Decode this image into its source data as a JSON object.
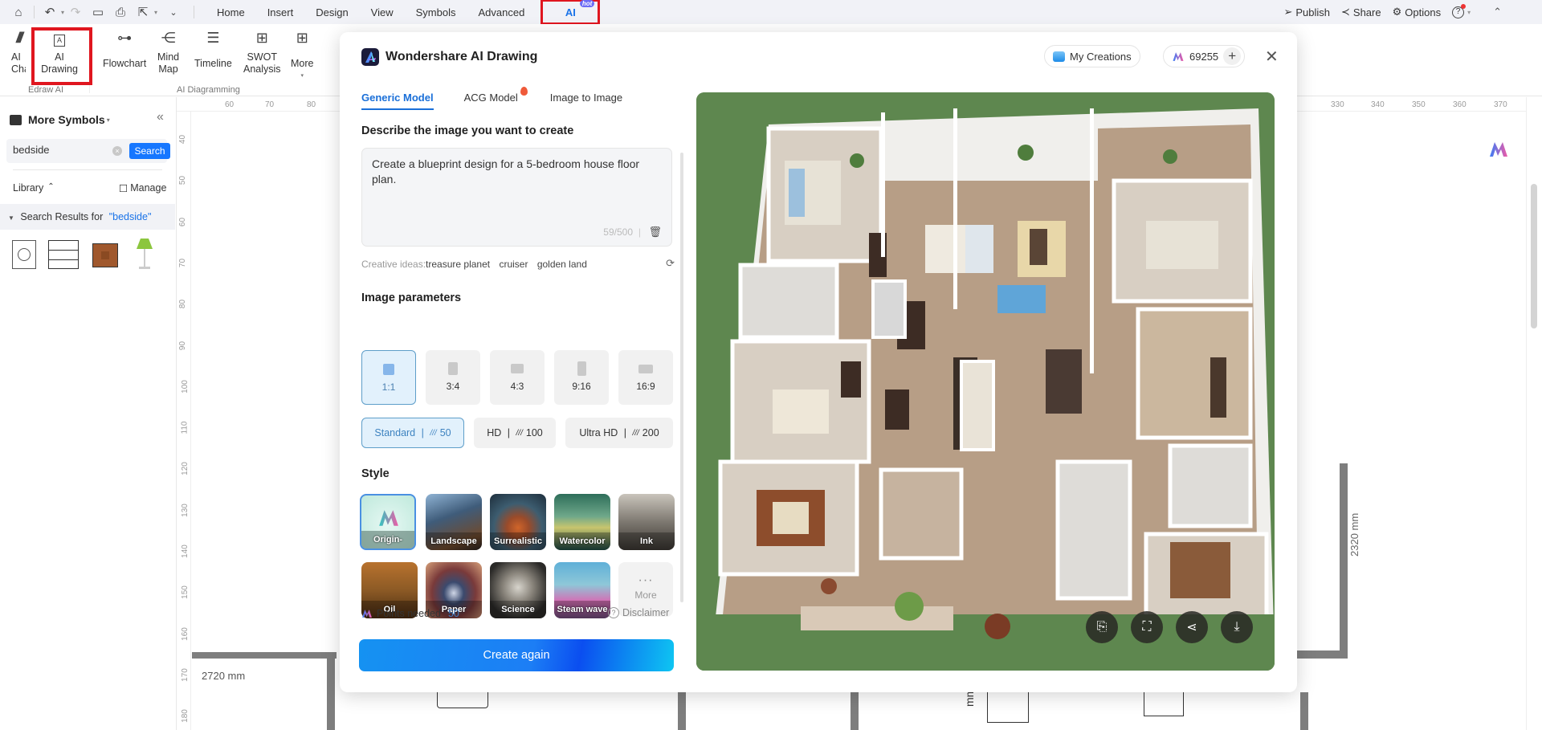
{
  "topbar": {
    "quick_icons": [
      "home-icon",
      "undo-icon",
      "redo-icon",
      "save-icon",
      "print-icon",
      "export-icon",
      "more-dropdown-icon"
    ],
    "menu": [
      "Home",
      "Insert",
      "Design",
      "View",
      "Symbols",
      "Advanced",
      "AI"
    ],
    "hot_badge": "hot",
    "actions": {
      "publish": "Publish",
      "share": "Share",
      "options": "Options"
    }
  },
  "ribbon": {
    "buttons": [
      {
        "label": "AI\nCha",
        "name": "ai-chat"
      },
      {
        "label": "AI\nDrawing",
        "name": "ai-drawing"
      },
      {
        "label": "Flowchart",
        "name": "flowchart"
      },
      {
        "label": "Mind\nMap",
        "name": "mind-map"
      },
      {
        "label": "Timeline",
        "name": "timeline"
      },
      {
        "label": "SWOT\nAnalysis",
        "name": "swot-analysis"
      },
      {
        "label": "More",
        "name": "more"
      }
    ],
    "groups": {
      "edraw_ai": "Edraw AI",
      "ai_diagramming": "AI Diagramming"
    }
  },
  "sidebar": {
    "title": "More Symbols",
    "search_value": "bedside",
    "search_button": "Search",
    "library_label": "Library",
    "manage_label": "Manage",
    "results_prefix": "Search Results for",
    "results_query": "\"bedside\"",
    "symbols": [
      "bedside-lamp-symbol",
      "bedside-drawer-symbol",
      "bedside-table-symbol",
      "table-lamp-symbol"
    ]
  },
  "ruler": {
    "top": [
      "60",
      "70",
      "80",
      "330",
      "340",
      "350",
      "360",
      "370"
    ],
    "left": [
      "40",
      "50",
      "60",
      "70",
      "80",
      "90",
      "100",
      "110",
      "120",
      "130",
      "140",
      "150",
      "160",
      "170",
      "180"
    ]
  },
  "canvas": {
    "dim_bottom_left": "2720 mm",
    "dim_right": "2320 mm",
    "dim_partial": "mm x"
  },
  "dialog": {
    "title": "Wondershare AI Drawing",
    "my_creations": "My Creations",
    "points_balance": "69255",
    "tabs": [
      "Generic Model",
      "ACG Model",
      "Image to Image"
    ],
    "active_tab": "Generic Model",
    "describe_heading": "Describe the image you want to create",
    "prompt": "Create a blueprint design for a 5-bedroom house floor plan.",
    "char_count": "59/500",
    "creative_label": "Creative ideas:",
    "creative_ideas": [
      "treasure planet",
      "cruiser",
      "golden land"
    ],
    "params_heading": "Image parameters",
    "ratios": [
      "1:1",
      "3:4",
      "4:3",
      "9:16",
      "16:9"
    ],
    "selected_ratio": "1:1",
    "qualities": [
      {
        "label": "Standard",
        "cost": "50"
      },
      {
        "label": "HD",
        "cost": "100"
      },
      {
        "label": "Ultra HD",
        "cost": "200"
      }
    ],
    "selected_quality": "Standard",
    "style_heading": "Style",
    "styles": [
      "Origin-com...",
      "Landscape",
      "Surrealistic",
      "Watercolor",
      "Ink",
      "Oil",
      "Paper",
      "Science",
      "Steam wave"
    ],
    "selected_style": "Origin-com...",
    "more_label": "More",
    "points_needed_label": "Points needed",
    "points_needed_value": "50",
    "disclaimer": "Disclaimer",
    "create_button": "Create again",
    "preview_actions": [
      "edit-icon",
      "fullscreen-icon",
      "share-icon",
      "download-icon"
    ],
    "preview_alt": "3D floor plan render of a 5-bedroom house"
  }
}
